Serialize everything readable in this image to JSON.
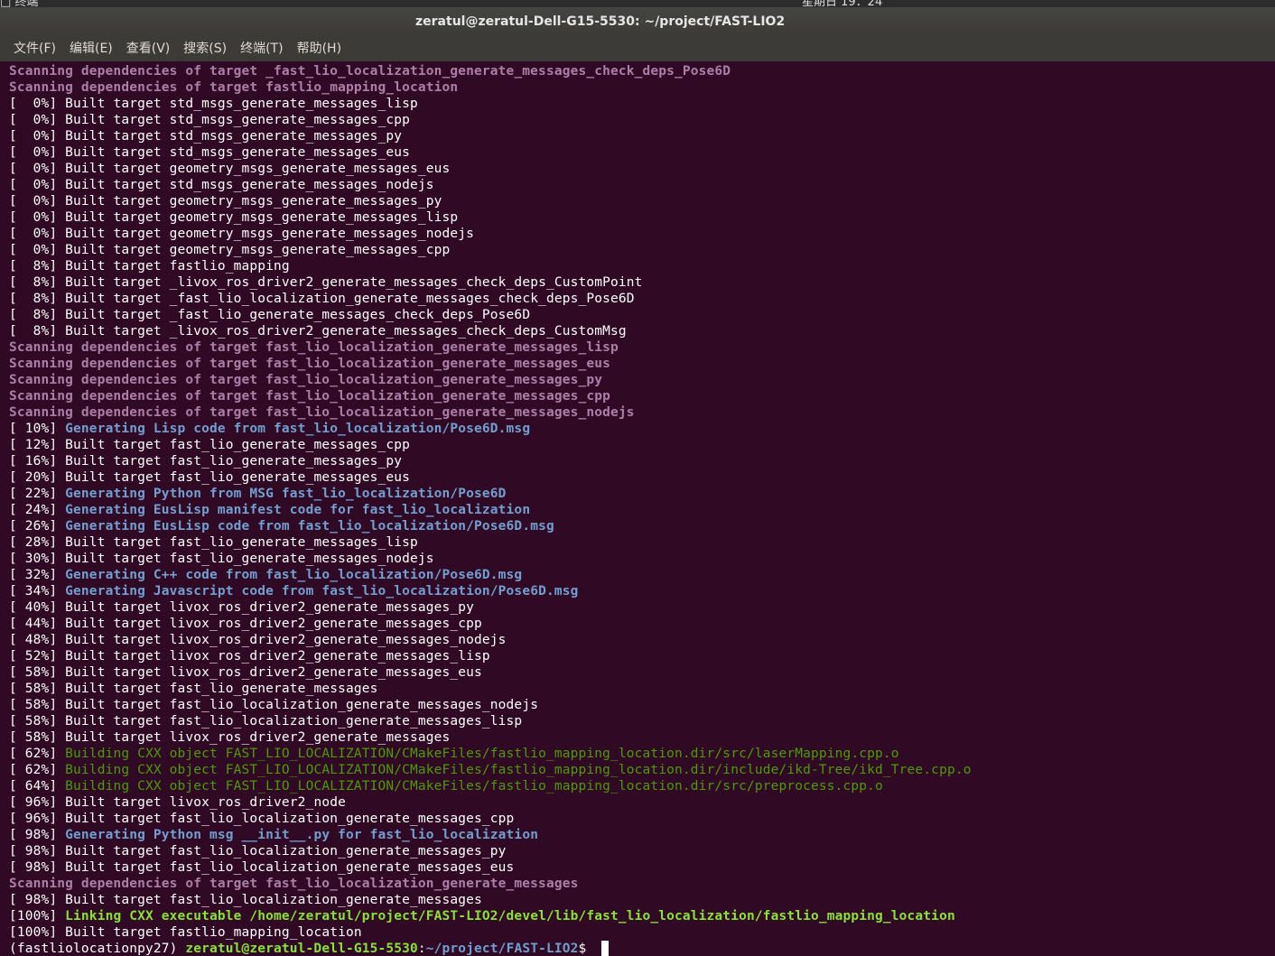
{
  "topbar": {
    "app_label": "□ 终端",
    "clock": "星期日 19：24"
  },
  "window": {
    "title": "zeratul@zeratul-Dell-G15-5530: ~/project/FAST-LIO2"
  },
  "menu": [
    "文件(F)",
    "编辑(E)",
    "查看(V)",
    "搜索(S)",
    "终端(T)",
    "帮助(H)"
  ],
  "lines": [
    {
      "type": "scan",
      "text": "Scanning dependencies of target _fast_lio_localization_generate_messages_check_deps_Pose6D"
    },
    {
      "type": "scan",
      "text": "Scanning dependencies of target fastlio_mapping_location"
    },
    {
      "type": "plain",
      "prefix": "[  0%] ",
      "text": "Built target std_msgs_generate_messages_lisp"
    },
    {
      "type": "plain",
      "prefix": "[  0%] ",
      "text": "Built target std_msgs_generate_messages_cpp"
    },
    {
      "type": "plain",
      "prefix": "[  0%] ",
      "text": "Built target std_msgs_generate_messages_py"
    },
    {
      "type": "plain",
      "prefix": "[  0%] ",
      "text": "Built target std_msgs_generate_messages_eus"
    },
    {
      "type": "plain",
      "prefix": "[  0%] ",
      "text": "Built target geometry_msgs_generate_messages_eus"
    },
    {
      "type": "plain",
      "prefix": "[  0%] ",
      "text": "Built target std_msgs_generate_messages_nodejs"
    },
    {
      "type": "plain",
      "prefix": "[  0%] ",
      "text": "Built target geometry_msgs_generate_messages_py"
    },
    {
      "type": "plain",
      "prefix": "[  0%] ",
      "text": "Built target geometry_msgs_generate_messages_lisp"
    },
    {
      "type": "plain",
      "prefix": "[  0%] ",
      "text": "Built target geometry_msgs_generate_messages_nodejs"
    },
    {
      "type": "plain",
      "prefix": "[  0%] ",
      "text": "Built target geometry_msgs_generate_messages_cpp"
    },
    {
      "type": "plain",
      "prefix": "[  8%] ",
      "text": "Built target fastlio_mapping"
    },
    {
      "type": "plain",
      "prefix": "[  8%] ",
      "text": "Built target _livox_ros_driver2_generate_messages_check_deps_CustomPoint"
    },
    {
      "type": "plain",
      "prefix": "[  8%] ",
      "text": "Built target _fast_lio_localization_generate_messages_check_deps_Pose6D"
    },
    {
      "type": "plain",
      "prefix": "[  8%] ",
      "text": "Built target _fast_lio_generate_messages_check_deps_Pose6D"
    },
    {
      "type": "plain",
      "prefix": "[  8%] ",
      "text": "Built target _livox_ros_driver2_generate_messages_check_deps_CustomMsg"
    },
    {
      "type": "scan",
      "text": "Scanning dependencies of target fast_lio_localization_generate_messages_lisp"
    },
    {
      "type": "scan",
      "text": "Scanning dependencies of target fast_lio_localization_generate_messages_eus"
    },
    {
      "type": "scan",
      "text": "Scanning dependencies of target fast_lio_localization_generate_messages_py"
    },
    {
      "type": "scan",
      "text": "Scanning dependencies of target fast_lio_localization_generate_messages_cpp"
    },
    {
      "type": "scan",
      "text": "Scanning dependencies of target fast_lio_localization_generate_messages_nodejs"
    },
    {
      "type": "gen",
      "prefix": "[ 10%] ",
      "text": "Generating Lisp code from fast_lio_localization/Pose6D.msg"
    },
    {
      "type": "plain",
      "prefix": "[ 12%] ",
      "text": "Built target fast_lio_generate_messages_cpp"
    },
    {
      "type": "plain",
      "prefix": "[ 16%] ",
      "text": "Built target fast_lio_generate_messages_py"
    },
    {
      "type": "plain",
      "prefix": "[ 20%] ",
      "text": "Built target fast_lio_generate_messages_eus"
    },
    {
      "type": "gen",
      "prefix": "[ 22%] ",
      "text": "Generating Python from MSG fast_lio_localization/Pose6D"
    },
    {
      "type": "gen",
      "prefix": "[ 24%] ",
      "text": "Generating EusLisp manifest code for fast_lio_localization"
    },
    {
      "type": "gen",
      "prefix": "[ 26%] ",
      "text": "Generating EusLisp code from fast_lio_localization/Pose6D.msg"
    },
    {
      "type": "plain",
      "prefix": "[ 28%] ",
      "text": "Built target fast_lio_generate_messages_lisp"
    },
    {
      "type": "plain",
      "prefix": "[ 30%] ",
      "text": "Built target fast_lio_generate_messages_nodejs"
    },
    {
      "type": "gen",
      "prefix": "[ 32%] ",
      "text": "Generating C++ code from fast_lio_localization/Pose6D.msg"
    },
    {
      "type": "gen",
      "prefix": "[ 34%] ",
      "text": "Generating Javascript code from fast_lio_localization/Pose6D.msg"
    },
    {
      "type": "plain",
      "prefix": "[ 40%] ",
      "text": "Built target livox_ros_driver2_generate_messages_py"
    },
    {
      "type": "plain",
      "prefix": "[ 44%] ",
      "text": "Built target livox_ros_driver2_generate_messages_cpp"
    },
    {
      "type": "plain",
      "prefix": "[ 48%] ",
      "text": "Built target livox_ros_driver2_generate_messages_nodejs"
    },
    {
      "type": "plain",
      "prefix": "[ 52%] ",
      "text": "Built target livox_ros_driver2_generate_messages_lisp"
    },
    {
      "type": "plain",
      "prefix": "[ 58%] ",
      "text": "Built target livox_ros_driver2_generate_messages_eus"
    },
    {
      "type": "plain",
      "prefix": "[ 58%] ",
      "text": "Built target fast_lio_generate_messages"
    },
    {
      "type": "plain",
      "prefix": "[ 58%] ",
      "text": "Built target fast_lio_localization_generate_messages_nodejs"
    },
    {
      "type": "plain",
      "prefix": "[ 58%] ",
      "text": "Built target fast_lio_localization_generate_messages_lisp"
    },
    {
      "type": "plain",
      "prefix": "[ 58%] ",
      "text": "Built target livox_ros_driver2_generate_messages"
    },
    {
      "type": "build",
      "prefix": "[ 62%] ",
      "text": "Building CXX object FAST_LIO_LOCALIZATION/CMakeFiles/fastlio_mapping_location.dir/src/laserMapping.cpp.o"
    },
    {
      "type": "build",
      "prefix": "[ 62%] ",
      "text": "Building CXX object FAST_LIO_LOCALIZATION/CMakeFiles/fastlio_mapping_location.dir/include/ikd-Tree/ikd_Tree.cpp.o"
    },
    {
      "type": "build",
      "prefix": "[ 64%] ",
      "text": "Building CXX object FAST_LIO_LOCALIZATION/CMakeFiles/fastlio_mapping_location.dir/src/preprocess.cpp.o"
    },
    {
      "type": "plain",
      "prefix": "[ 96%] ",
      "text": "Built target livox_ros_driver2_node"
    },
    {
      "type": "plain",
      "prefix": "[ 96%] ",
      "text": "Built target fast_lio_localization_generate_messages_cpp"
    },
    {
      "type": "gen",
      "prefix": "[ 98%] ",
      "text": "Generating Python msg __init__.py for fast_lio_localization"
    },
    {
      "type": "plain",
      "prefix": "[ 98%] ",
      "text": "Built target fast_lio_localization_generate_messages_py"
    },
    {
      "type": "plain",
      "prefix": "[ 98%] ",
      "text": "Built target fast_lio_localization_generate_messages_eus"
    },
    {
      "type": "scan",
      "text": "Scanning dependencies of target fast_lio_localization_generate_messages"
    },
    {
      "type": "plain",
      "prefix": "[ 98%] ",
      "text": "Built target fast_lio_localization_generate_messages"
    },
    {
      "type": "link",
      "prefix": "[100%] ",
      "text": "Linking CXX executable /home/zeratul/project/FAST-LIO2/devel/lib/fast_lio_localization/fastlio_mapping_location"
    },
    {
      "type": "plain",
      "prefix": "[100%] ",
      "text": "Built target fastlio_mapping_location"
    }
  ],
  "prompt": {
    "env": "(fastliolocationpy27) ",
    "user_host": "zeratul@zeratul-Dell-G15-5530",
    "separator": ":",
    "path": "~/project/FAST-LIO2",
    "symbol": "$ "
  },
  "colors": {
    "background": "#300a24",
    "scan": "#ad7fa8",
    "generate": "#729fcf",
    "build": "#4e9a06",
    "link": "#8ae234"
  }
}
